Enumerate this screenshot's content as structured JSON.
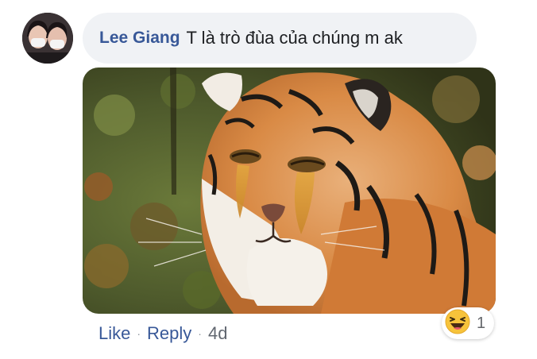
{
  "comment": {
    "author": "Lee Giang",
    "text": "T là trò đùa của chúng m ak",
    "attachment": {
      "type": "photo",
      "subject": "crying-tiger-meme"
    }
  },
  "actions": {
    "like_label": "Like",
    "separator": "·",
    "reply_label": "Reply",
    "timestamp": "4d"
  },
  "reactions": {
    "emoji": "haha-icon",
    "count": "1"
  },
  "colors": {
    "author": "#385898",
    "bubble": "#f0f2f5",
    "text": "#1c1e21",
    "muted": "#616770"
  }
}
